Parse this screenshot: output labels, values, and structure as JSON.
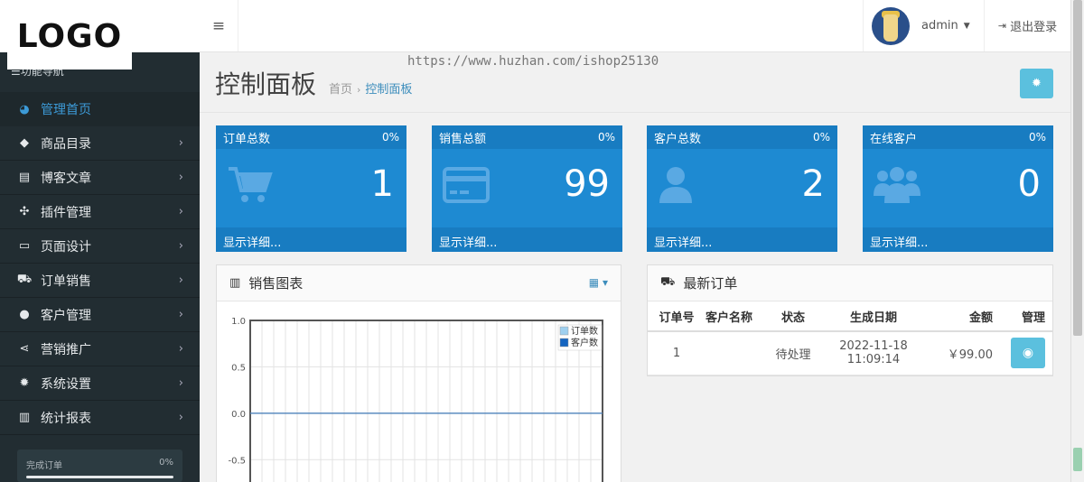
{
  "logo": {
    "text": "LOGO"
  },
  "sidebar": {
    "title": "功能导航",
    "items": [
      {
        "label": "管理首页",
        "icon": "dashboard-icon",
        "glyph": "◕",
        "active": true
      },
      {
        "label": "商品目录",
        "icon": "tag-icon",
        "glyph": "◆"
      },
      {
        "label": "博客文章",
        "icon": "newspaper-icon",
        "glyph": "▤"
      },
      {
        "label": "插件管理",
        "icon": "puzzle-icon",
        "glyph": "✣"
      },
      {
        "label": "页面设计",
        "icon": "monitor-icon",
        "glyph": "▭"
      },
      {
        "label": "订单销售",
        "icon": "cart-icon",
        "glyph": "⛟"
      },
      {
        "label": "客户管理",
        "icon": "user-icon",
        "glyph": "●"
      },
      {
        "label": "营销推广",
        "icon": "share-icon",
        "glyph": "⋖"
      },
      {
        "label": "系统设置",
        "icon": "cog-icon",
        "glyph": "✹"
      },
      {
        "label": "统计报表",
        "icon": "bar-chart-icon",
        "glyph": "▥"
      }
    ],
    "progress": {
      "label": "完成订单",
      "value": "0%"
    }
  },
  "topbar": {
    "menu_icon": "≡",
    "user_name": "admin",
    "logout_label": "退出登录"
  },
  "watermark": "https://www.huzhan.com/ishop25130",
  "page": {
    "title": "控制面板",
    "breadcrumb_home": "首页",
    "breadcrumb_current": "控制面板"
  },
  "tiles": [
    {
      "title": "订单总数",
      "percent": "0%",
      "value": "1",
      "icon": "cart-icon",
      "footer": "显示详细..."
    },
    {
      "title": "销售总额",
      "percent": "0%",
      "value": "99",
      "icon": "credit-card-icon",
      "footer": "显示详细..."
    },
    {
      "title": "客户总数",
      "percent": "0%",
      "value": "2",
      "icon": "user-icon",
      "footer": "显示详细..."
    },
    {
      "title": "在线客户",
      "percent": "0%",
      "value": "0",
      "icon": "users-icon",
      "footer": "显示详细..."
    }
  ],
  "sales_panel": {
    "title": "销售图表"
  },
  "chart_data": {
    "type": "line",
    "title": "",
    "xlabel": "",
    "ylabel": "",
    "ylim": [
      -0.75,
      1.0
    ],
    "yticks": [
      "1.0",
      "0.5",
      "0.0",
      "-0.5"
    ],
    "grid": true,
    "legend_placement": "top-right",
    "series": [
      {
        "name": "订单数",
        "color": "#9fd0ef",
        "values": [
          0,
          0
        ]
      },
      {
        "name": "客户数",
        "color": "#1565c0",
        "values": [
          0,
          0
        ]
      }
    ]
  },
  "orders_panel": {
    "title": "最新订单",
    "columns": [
      "订单号",
      "客户名称",
      "状态",
      "生成日期",
      "金额",
      "管理"
    ],
    "rows": [
      {
        "id": "1",
        "customer": "",
        "status": "待处理",
        "date": "2022-11-18 11:09:14",
        "amount": "￥99.00"
      }
    ]
  },
  "colors": {
    "tile": "#1e8ad2",
    "tile_dark": "#187cc1",
    "sidebar": "#222d32",
    "accent": "#3c8dbc",
    "info_button": "#5bc0de"
  }
}
